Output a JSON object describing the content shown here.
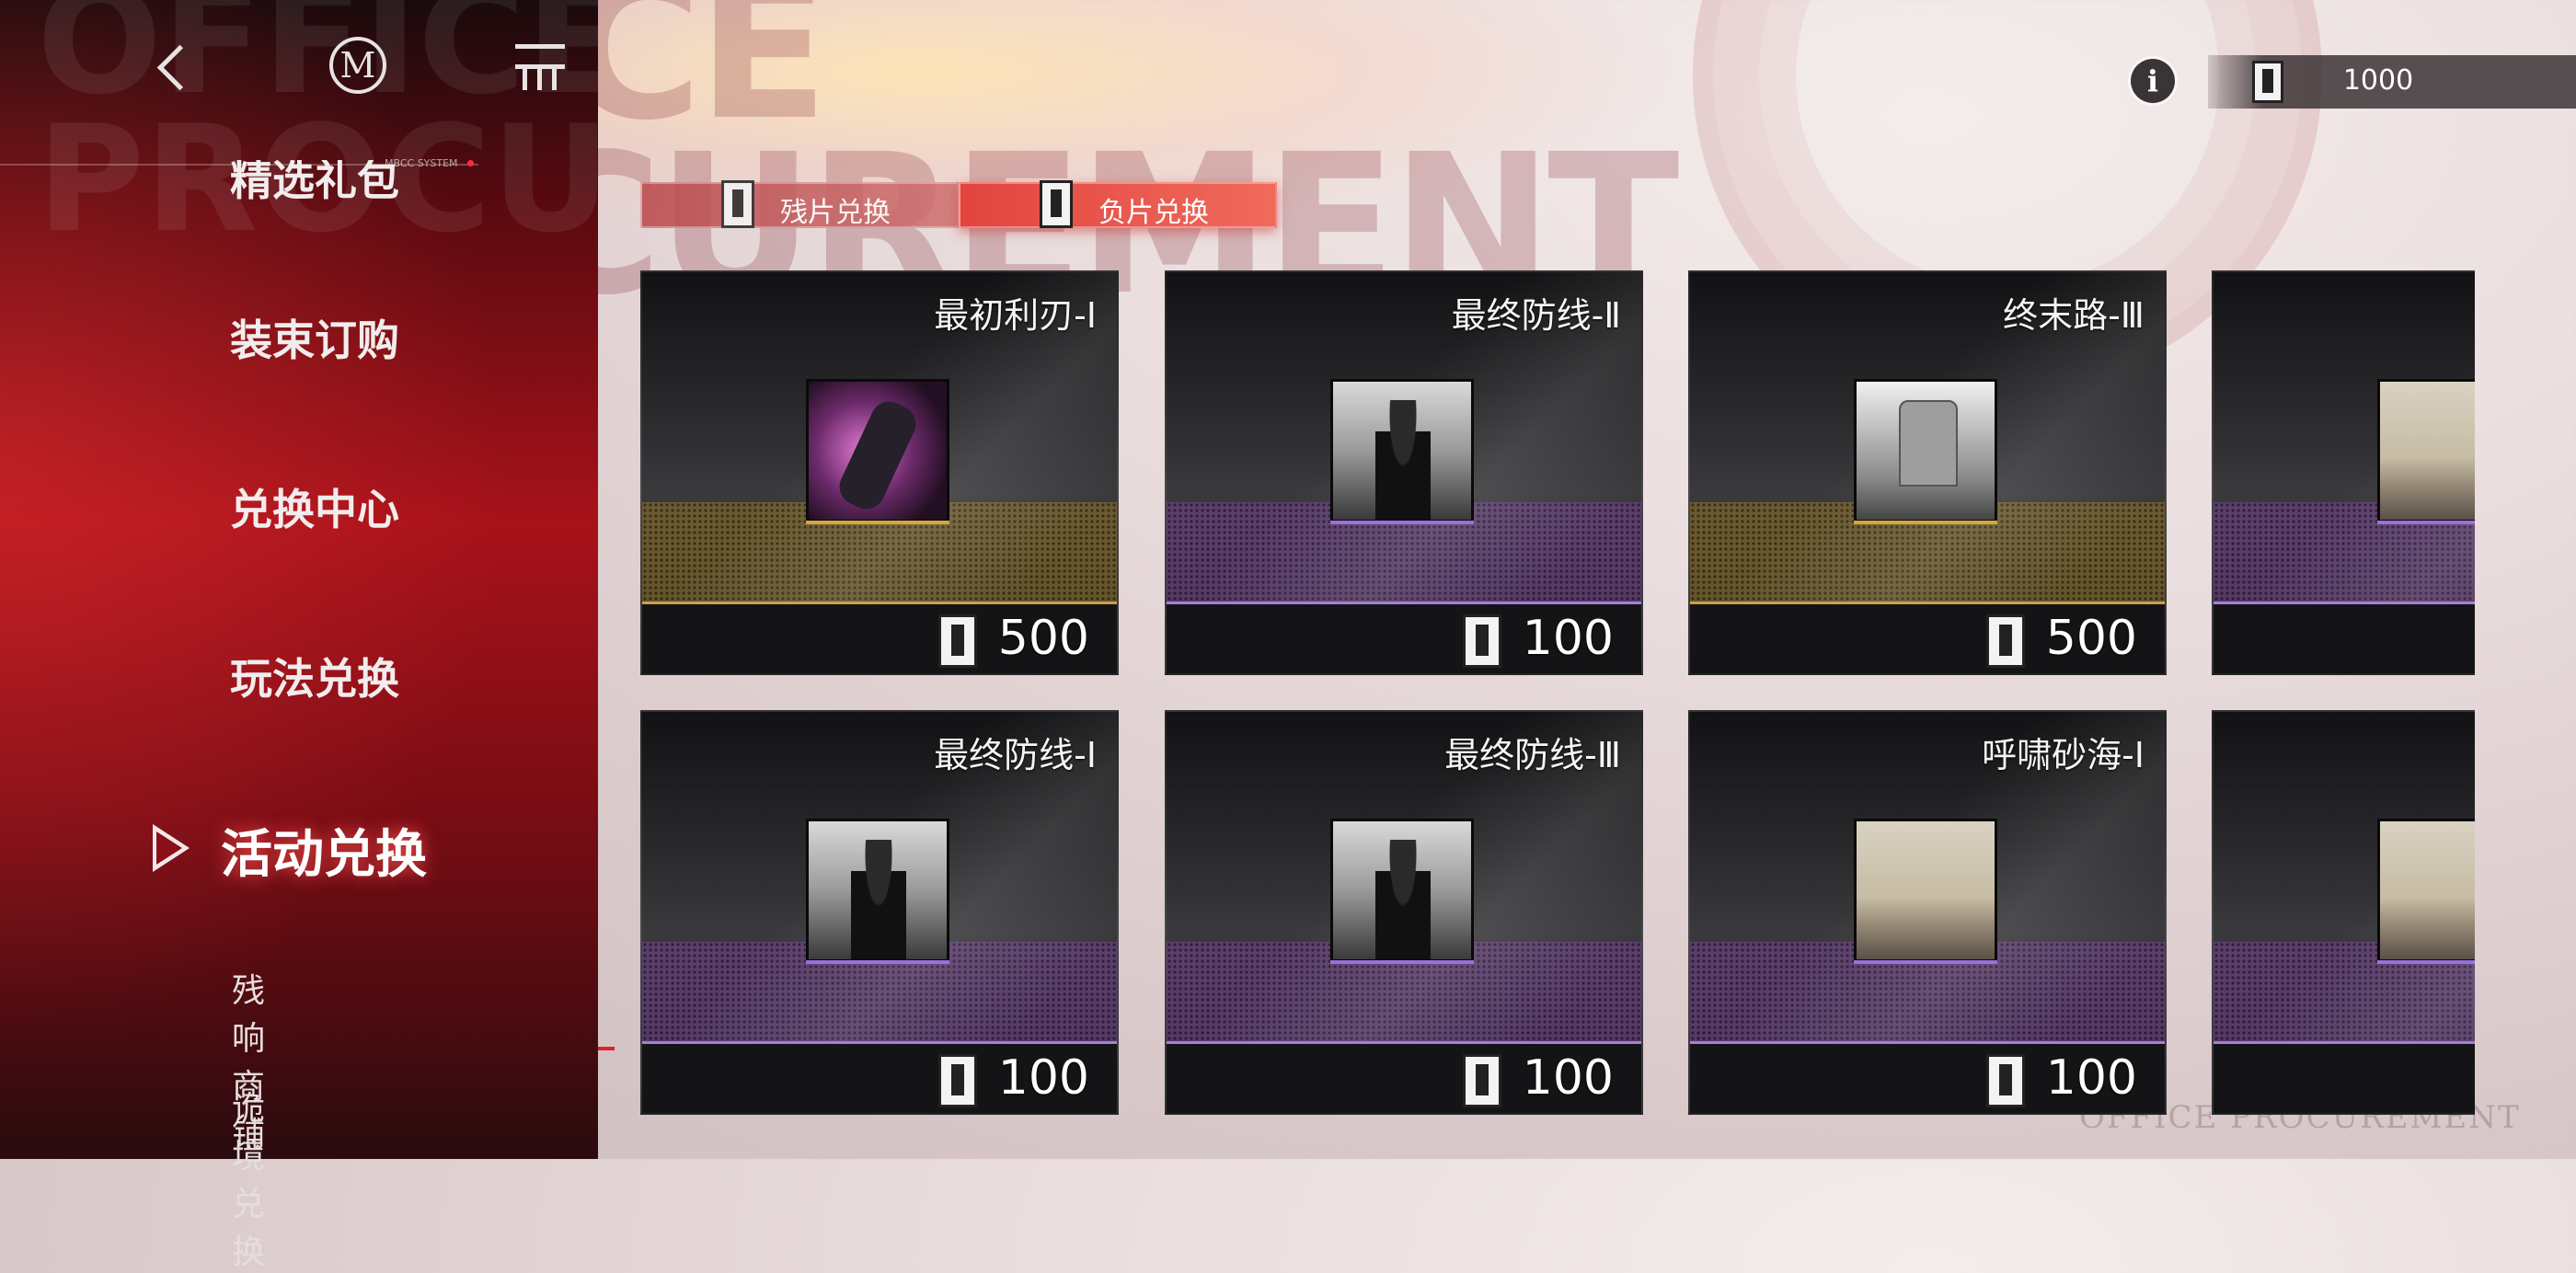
{
  "background": {
    "watermark": "OFFICE\nPROCUREMENT",
    "footer_watermark": "OFFICE PROCUREMENT"
  },
  "header": {
    "logo": "M",
    "currency": {
      "icon": "film-token-icon",
      "value": "1000"
    }
  },
  "sidebar": {
    "system_label": "MBCC SYSTEM",
    "items": [
      {
        "label": "精选礼包",
        "partial": true
      },
      {
        "label": "装束订购"
      },
      {
        "label": "兑换中心"
      },
      {
        "label": "玩法兑换"
      },
      {
        "label": "活动兑换",
        "active": true
      },
      {
        "label": "残响商铺"
      },
      {
        "label": "诡境兑换"
      }
    ]
  },
  "tabs": [
    {
      "label": "残片兑换",
      "active": false
    },
    {
      "label": "负片兑换",
      "active": true
    }
  ],
  "cards": [
    {
      "title": "最初利刃-Ⅰ",
      "price": "500",
      "rarity": "gold",
      "image": "pink-creature"
    },
    {
      "title": "最终防线-Ⅱ",
      "price": "100",
      "rarity": "purple",
      "image": "man-in-coat"
    },
    {
      "title": "终末路-Ⅲ",
      "price": "500",
      "rarity": "gold",
      "image": "tombstone"
    },
    {
      "title": "",
      "price": "",
      "rarity": "purple",
      "image": "sand-landscape"
    },
    {
      "title": "最终防线-Ⅰ",
      "price": "100",
      "rarity": "purple",
      "image": "man-in-coat"
    },
    {
      "title": "最终防线-Ⅲ",
      "price": "100",
      "rarity": "purple",
      "image": "man-in-coat"
    },
    {
      "title": "呼啸砂海-Ⅰ",
      "price": "100",
      "rarity": "purple",
      "image": "sand-landscape"
    },
    {
      "title": "",
      "price": "",
      "rarity": "purple",
      "image": "sand-landscape"
    }
  ],
  "colors": {
    "accent_red": "#c8121a",
    "gold": "#c8a24a",
    "purple": "#a57fd6"
  }
}
